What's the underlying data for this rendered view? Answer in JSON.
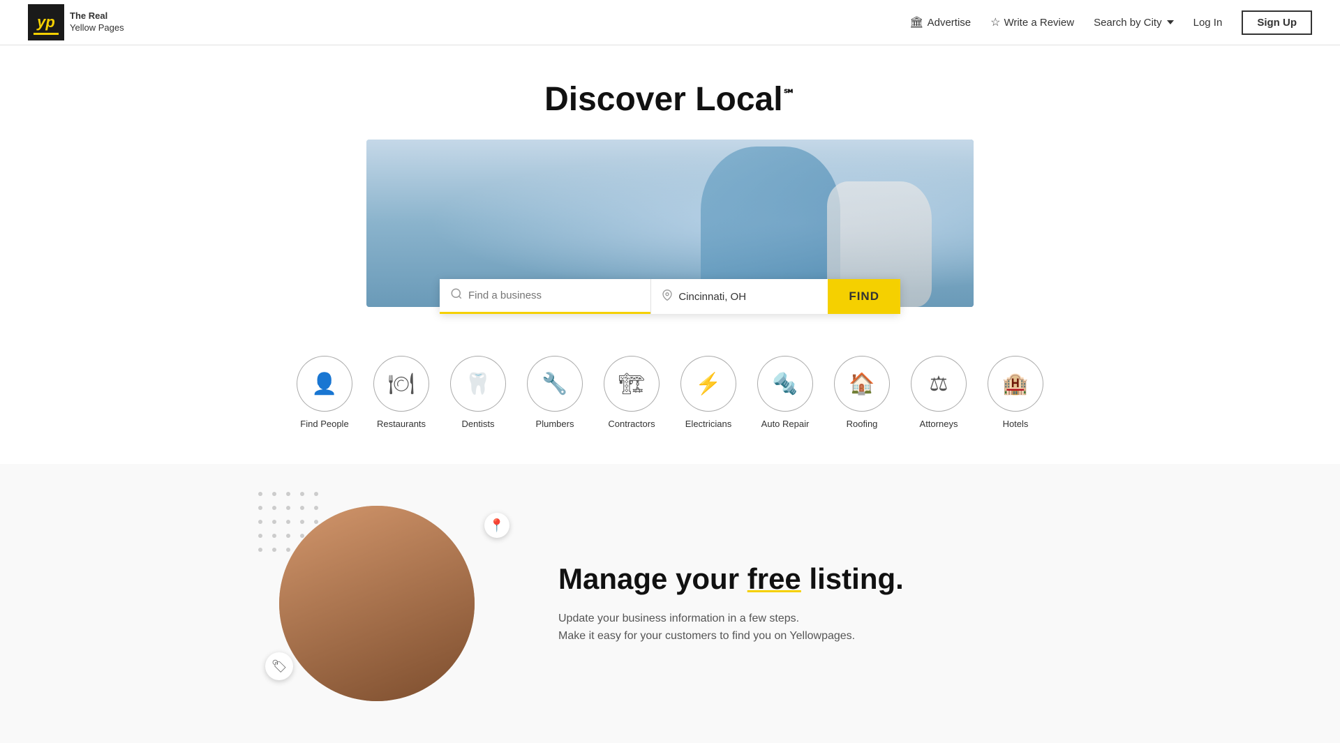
{
  "header": {
    "logo": {
      "yp_text": "yp",
      "tagline_line1": "The Real",
      "tagline_line2": "Yellow Pages"
    },
    "nav": {
      "advertise": "Advertise",
      "write_review": "Write a Review",
      "search_by_city": "Search by City",
      "login": "Log In",
      "signup": "Sign Up"
    }
  },
  "hero": {
    "title": "Discover Local",
    "title_sup": "℠"
  },
  "search": {
    "business_placeholder": "Find a business",
    "location_value": "Cincinnati, OH",
    "find_button": "FIND"
  },
  "categories": [
    {
      "id": "find-people",
      "label": "Find People",
      "icon": "👤"
    },
    {
      "id": "restaurants",
      "label": "Restaurants",
      "icon": "🍽"
    },
    {
      "id": "dentists",
      "label": "Dentists",
      "icon": "🦷"
    },
    {
      "id": "plumbers",
      "label": "Plumbers",
      "icon": "🔧"
    },
    {
      "id": "contractors",
      "label": "Contractors",
      "icon": "🏗"
    },
    {
      "id": "electricians",
      "label": "Electricians",
      "icon": "⚡"
    },
    {
      "id": "auto-repair",
      "label": "Auto Repair",
      "icon": "🔩"
    },
    {
      "id": "roofing",
      "label": "Roofing",
      "icon": "🏠"
    },
    {
      "id": "attorneys",
      "label": "Attorneys",
      "icon": "⚖"
    },
    {
      "id": "hotels",
      "label": "Hotels",
      "icon": "🏨"
    }
  ],
  "manage_section": {
    "heading_pre": "Manage your ",
    "heading_free": "free",
    "heading_post": " listing.",
    "subtext_line1": "Update your business information in a few steps.",
    "subtext_line2": "Make it easy for your customers to find you on Yellowpages."
  }
}
